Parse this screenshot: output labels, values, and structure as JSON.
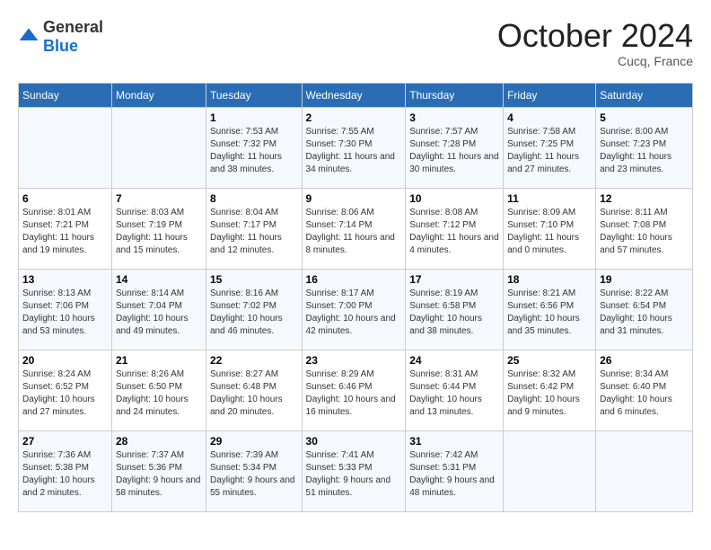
{
  "header": {
    "logo_general": "General",
    "logo_blue": "Blue",
    "month_title": "October 2024",
    "location": "Cucq, France"
  },
  "days_of_week": [
    "Sunday",
    "Monday",
    "Tuesday",
    "Wednesday",
    "Thursday",
    "Friday",
    "Saturday"
  ],
  "weeks": [
    [
      {
        "day": "",
        "detail": ""
      },
      {
        "day": "",
        "detail": ""
      },
      {
        "day": "1",
        "detail": "Sunrise: 7:53 AM\nSunset: 7:32 PM\nDaylight: 11 hours and 38 minutes."
      },
      {
        "day": "2",
        "detail": "Sunrise: 7:55 AM\nSunset: 7:30 PM\nDaylight: 11 hours and 34 minutes."
      },
      {
        "day": "3",
        "detail": "Sunrise: 7:57 AM\nSunset: 7:28 PM\nDaylight: 11 hours and 30 minutes."
      },
      {
        "day": "4",
        "detail": "Sunrise: 7:58 AM\nSunset: 7:25 PM\nDaylight: 11 hours and 27 minutes."
      },
      {
        "day": "5",
        "detail": "Sunrise: 8:00 AM\nSunset: 7:23 PM\nDaylight: 11 hours and 23 minutes."
      }
    ],
    [
      {
        "day": "6",
        "detail": "Sunrise: 8:01 AM\nSunset: 7:21 PM\nDaylight: 11 hours and 19 minutes."
      },
      {
        "day": "7",
        "detail": "Sunrise: 8:03 AM\nSunset: 7:19 PM\nDaylight: 11 hours and 15 minutes."
      },
      {
        "day": "8",
        "detail": "Sunrise: 8:04 AM\nSunset: 7:17 PM\nDaylight: 11 hours and 12 minutes."
      },
      {
        "day": "9",
        "detail": "Sunrise: 8:06 AM\nSunset: 7:14 PM\nDaylight: 11 hours and 8 minutes."
      },
      {
        "day": "10",
        "detail": "Sunrise: 8:08 AM\nSunset: 7:12 PM\nDaylight: 11 hours and 4 minutes."
      },
      {
        "day": "11",
        "detail": "Sunrise: 8:09 AM\nSunset: 7:10 PM\nDaylight: 11 hours and 0 minutes."
      },
      {
        "day": "12",
        "detail": "Sunrise: 8:11 AM\nSunset: 7:08 PM\nDaylight: 10 hours and 57 minutes."
      }
    ],
    [
      {
        "day": "13",
        "detail": "Sunrise: 8:13 AM\nSunset: 7:06 PM\nDaylight: 10 hours and 53 minutes."
      },
      {
        "day": "14",
        "detail": "Sunrise: 8:14 AM\nSunset: 7:04 PM\nDaylight: 10 hours and 49 minutes."
      },
      {
        "day": "15",
        "detail": "Sunrise: 8:16 AM\nSunset: 7:02 PM\nDaylight: 10 hours and 46 minutes."
      },
      {
        "day": "16",
        "detail": "Sunrise: 8:17 AM\nSunset: 7:00 PM\nDaylight: 10 hours and 42 minutes."
      },
      {
        "day": "17",
        "detail": "Sunrise: 8:19 AM\nSunset: 6:58 PM\nDaylight: 10 hours and 38 minutes."
      },
      {
        "day": "18",
        "detail": "Sunrise: 8:21 AM\nSunset: 6:56 PM\nDaylight: 10 hours and 35 minutes."
      },
      {
        "day": "19",
        "detail": "Sunrise: 8:22 AM\nSunset: 6:54 PM\nDaylight: 10 hours and 31 minutes."
      }
    ],
    [
      {
        "day": "20",
        "detail": "Sunrise: 8:24 AM\nSunset: 6:52 PM\nDaylight: 10 hours and 27 minutes."
      },
      {
        "day": "21",
        "detail": "Sunrise: 8:26 AM\nSunset: 6:50 PM\nDaylight: 10 hours and 24 minutes."
      },
      {
        "day": "22",
        "detail": "Sunrise: 8:27 AM\nSunset: 6:48 PM\nDaylight: 10 hours and 20 minutes."
      },
      {
        "day": "23",
        "detail": "Sunrise: 8:29 AM\nSunset: 6:46 PM\nDaylight: 10 hours and 16 minutes."
      },
      {
        "day": "24",
        "detail": "Sunrise: 8:31 AM\nSunset: 6:44 PM\nDaylight: 10 hours and 13 minutes."
      },
      {
        "day": "25",
        "detail": "Sunrise: 8:32 AM\nSunset: 6:42 PM\nDaylight: 10 hours and 9 minutes."
      },
      {
        "day": "26",
        "detail": "Sunrise: 8:34 AM\nSunset: 6:40 PM\nDaylight: 10 hours and 6 minutes."
      }
    ],
    [
      {
        "day": "27",
        "detail": "Sunrise: 7:36 AM\nSunset: 5:38 PM\nDaylight: 10 hours and 2 minutes."
      },
      {
        "day": "28",
        "detail": "Sunrise: 7:37 AM\nSunset: 5:36 PM\nDaylight: 9 hours and 58 minutes."
      },
      {
        "day": "29",
        "detail": "Sunrise: 7:39 AM\nSunset: 5:34 PM\nDaylight: 9 hours and 55 minutes."
      },
      {
        "day": "30",
        "detail": "Sunrise: 7:41 AM\nSunset: 5:33 PM\nDaylight: 9 hours and 51 minutes."
      },
      {
        "day": "31",
        "detail": "Sunrise: 7:42 AM\nSunset: 5:31 PM\nDaylight: 9 hours and 48 minutes."
      },
      {
        "day": "",
        "detail": ""
      },
      {
        "day": "",
        "detail": ""
      }
    ]
  ]
}
